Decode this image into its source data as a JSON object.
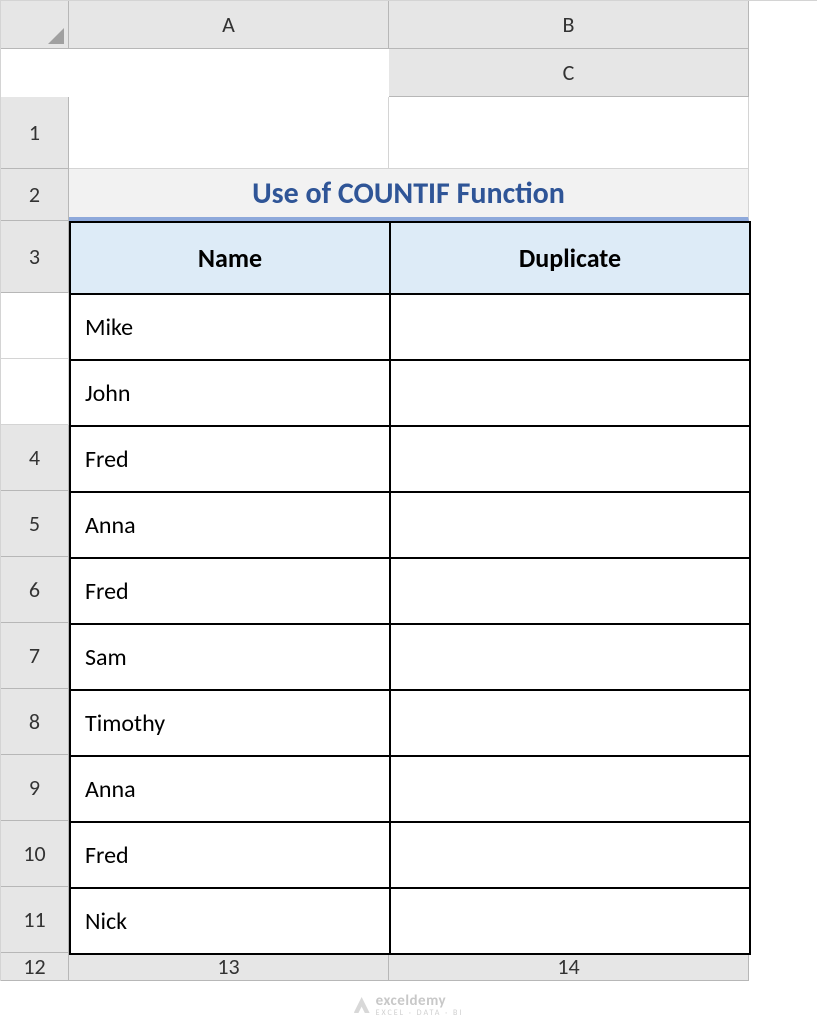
{
  "columns": [
    "A",
    "B",
    "C"
  ],
  "rows": [
    "1",
    "2",
    "3",
    "4",
    "5",
    "6",
    "7",
    "8",
    "9",
    "10",
    "11",
    "12",
    "13",
    "14"
  ],
  "title": "Use of COUNTIF Function",
  "headers": {
    "name": "Name",
    "duplicate": "Duplicate"
  },
  "data": [
    {
      "name": "Mike",
      "duplicate": ""
    },
    {
      "name": "John",
      "duplicate": ""
    },
    {
      "name": "Fred",
      "duplicate": ""
    },
    {
      "name": "Anna",
      "duplicate": ""
    },
    {
      "name": "Fred",
      "duplicate": ""
    },
    {
      "name": "Sam",
      "duplicate": ""
    },
    {
      "name": "Timothy",
      "duplicate": ""
    },
    {
      "name": "Anna",
      "duplicate": ""
    },
    {
      "name": "Fred",
      "duplicate": ""
    },
    {
      "name": "Nick",
      "duplicate": ""
    }
  ],
  "watermark": {
    "brand": "exceldemy",
    "tagline": "EXCEL · DATA · BI"
  }
}
